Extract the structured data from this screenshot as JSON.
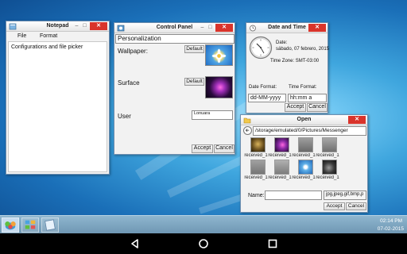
{
  "notepad": {
    "title": "Notepad",
    "menu": [
      "File",
      "Format"
    ],
    "content": "Configurations and file picker"
  },
  "control_panel": {
    "title": "Control Panel",
    "section": "Personalization",
    "wallpaper_label": "Wallpaper:",
    "surface_label": "Surface",
    "user_label": "User",
    "default_label": "Default",
    "user_value": "Lonuara",
    "accept_label": "Accept",
    "cancel_label": "Cancel"
  },
  "date_time": {
    "title": "Date and Time",
    "date_label": "Date:",
    "date_value": "sábado, 07 febrero, 2015",
    "timezone": "Time Zone: SMT-03:00",
    "date_format_label": "Date Format:",
    "time_format_label": "Time Format:",
    "date_format_value": "dd-MM-yyyy",
    "time_format_value": "hh:mm a",
    "accept_label": "Accept",
    "cancel_label": "Cancel"
  },
  "open_dialog": {
    "title": "Open",
    "path": "/storage/emulated/0/Pictures/Messenger",
    "files": [
      "received_1",
      "received_1",
      "received_1",
      "received_1",
      "received_1",
      "received_1",
      "received_1",
      "received_1"
    ],
    "name_label": "Name:",
    "name_value": "",
    "filter": "jpg,jpeg,gif,bmp,p",
    "accept_label": "Accept",
    "cancel_label": "Cancel"
  },
  "taskbar": {
    "time": "02:14 PM",
    "date": "07-02-2015"
  },
  "colors": {
    "close_button": "#d9342b",
    "taskbar": "#7fa6c2",
    "desktop": "#3fa6de"
  }
}
